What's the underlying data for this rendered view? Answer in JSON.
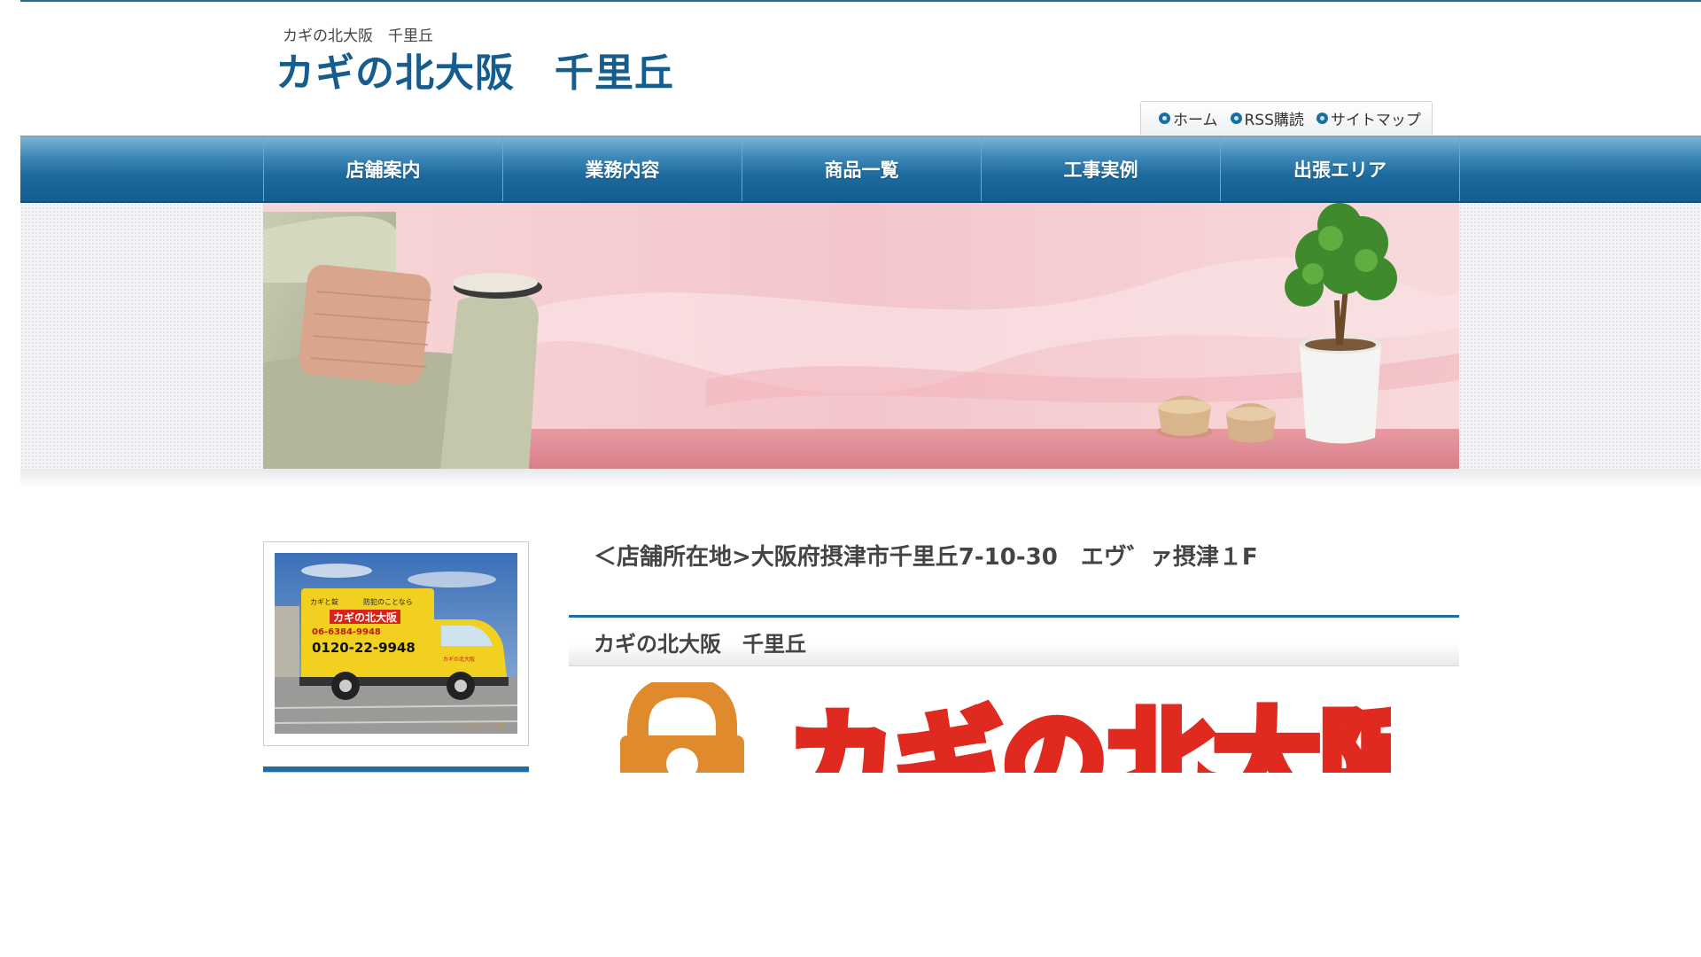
{
  "header": {
    "subtitle": "カギの北大阪　千里丘",
    "title": "カギの北大阪　千里丘"
  },
  "utility_nav": [
    {
      "label": "ホーム"
    },
    {
      "label": "RSS購読"
    },
    {
      "label": "サイトマップ"
    }
  ],
  "global_nav": [
    {
      "label": "店舗案内"
    },
    {
      "label": "業務内容"
    },
    {
      "label": "商品一覧"
    },
    {
      "label": "工事実例"
    },
    {
      "label": "出張エリア"
    }
  ],
  "truck": {
    "line1": "カギと錠",
    "line2": "防犯のことなら",
    "brand": "カギの北大阪",
    "phone1": "06-6384-9948",
    "phone2": "0120-22-9948",
    "door_text": "カギの北大阪",
    "stamp": "2020/12/10 10:38"
  },
  "main": {
    "address": "＜店舗所在地>大阪府摂津市千里丘7-10-30　エヴ゛ァ摂津１F",
    "section_title": "カギの北大阪　千里丘",
    "logo_text": "カギの北大阪"
  },
  "colors": {
    "brand_blue": "#145d8c",
    "nav_blue": "#1d6a9e",
    "logo_orange": "#e08a2e",
    "logo_red": "#e02a1f"
  }
}
